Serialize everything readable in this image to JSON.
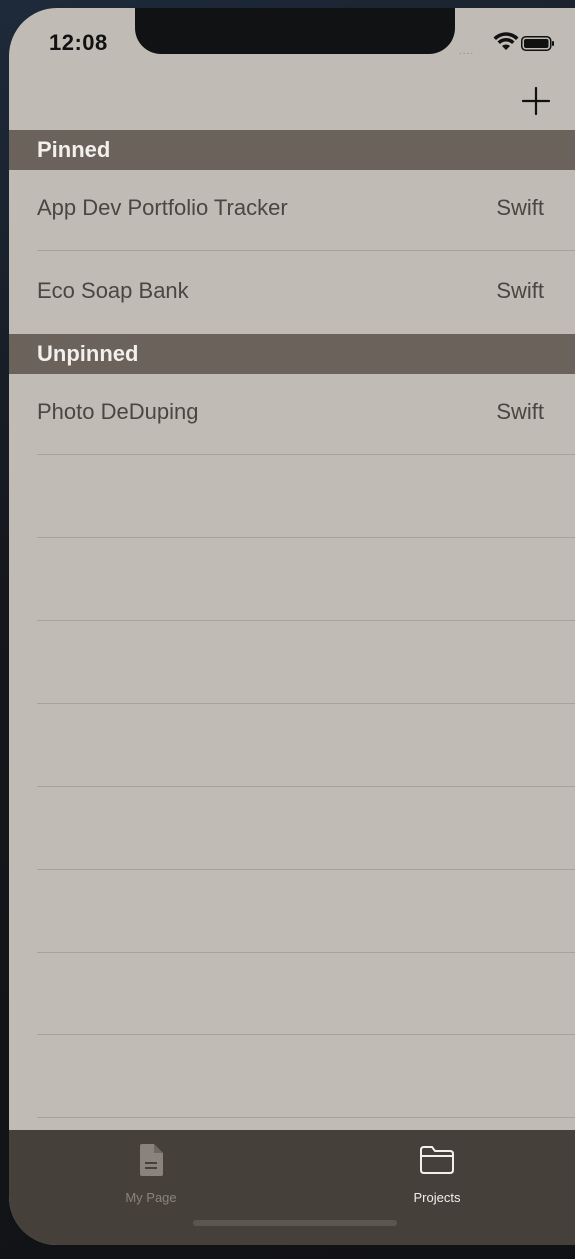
{
  "status_bar": {
    "time": "12:08",
    "signal": "....",
    "icons": [
      "wifi-icon",
      "battery-icon"
    ]
  },
  "nav": {
    "add_icon": "plus-icon"
  },
  "sections": {
    "pinned": {
      "header": "Pinned",
      "rows": [
        {
          "title": "App Dev Portfolio Tracker",
          "language": "Swift"
        },
        {
          "title": "Eco Soap Bank",
          "language": "Swift"
        }
      ]
    },
    "unpinned": {
      "header": "Unpinned",
      "rows": [
        {
          "title": "Photo DeDuping",
          "language": "Swift"
        }
      ]
    }
  },
  "tab_bar": {
    "tabs": [
      {
        "label": "My Page",
        "icon": "document-icon",
        "selected": false
      },
      {
        "label": "Projects",
        "icon": "folder-icon",
        "selected": true
      }
    ]
  },
  "colors": {
    "background": "#c0bbb4",
    "section_header": "#6a625b",
    "tab_bar": "#46403b",
    "tab_selected": "#f2efec",
    "tab_unselected": "#8a837d"
  }
}
